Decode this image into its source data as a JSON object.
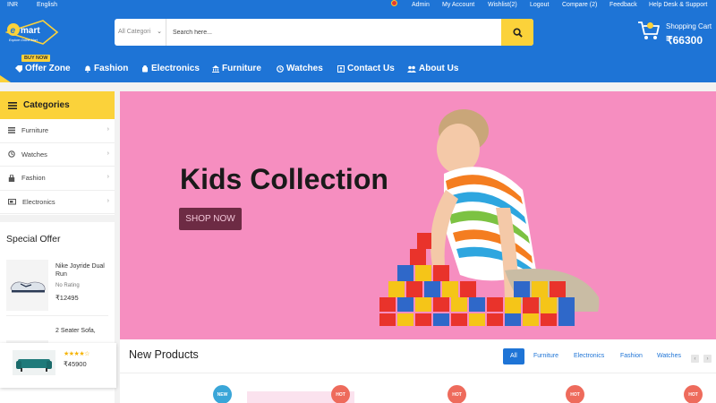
{
  "topbar": {
    "currency": "INR",
    "language": "English",
    "links": [
      "Admin",
      "My Account",
      "Wishlist(2)",
      "Logout",
      "Compare (2)",
      "Feedback",
      "Help Desk & Support"
    ]
  },
  "header": {
    "logo_text": "mart",
    "logo_tagline": "Explore Online Mart",
    "search": {
      "category": "All Categori",
      "placeholder": "Search here..."
    },
    "cart": {
      "label": "Shopping Cart",
      "total": "₹66300"
    }
  },
  "nav": {
    "buy_now": "BUY NOW",
    "items": [
      "Offer Zone",
      "Fashion",
      "Electronics",
      "Furniture",
      "Watches",
      "Contact Us",
      "About Us"
    ]
  },
  "sidebar": {
    "title": "Categories",
    "items": [
      "Furniture",
      "Watches",
      "Fashion",
      "Electronics"
    ]
  },
  "special_offer": {
    "title": "Special Offer",
    "products": [
      {
        "name": "Nike Joyride Dual Run",
        "rating": "No Rating",
        "price": "₹12495"
      },
      {
        "name": "2 Seater Sofa,"
      }
    ]
  },
  "recent_popup": {
    "price": "₹45900",
    "stars": "★★★★☆"
  },
  "banner": {
    "title": "Kids Collection",
    "button": "SHOP NOW"
  },
  "new_products": {
    "title": "New Products",
    "tabs": [
      "All",
      "Furniture",
      "Electronics",
      "Fashion",
      "Watches"
    ],
    "badges": [
      "NEW",
      "HOT",
      "HOT",
      "HOT",
      "HOT"
    ]
  },
  "colors": {
    "primary": "#1e74d6",
    "accent": "#fbd23a",
    "banner_bg": "#f68ec0",
    "button": "#6d2b44"
  }
}
